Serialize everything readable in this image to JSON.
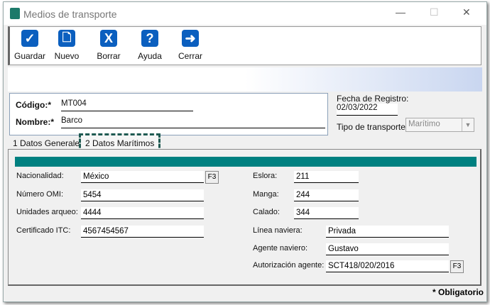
{
  "window": {
    "title": "Medios de transporte",
    "minimize": "—",
    "maximize": "☐",
    "close": "✕"
  },
  "toolbar": [
    {
      "label": "Guardar",
      "icon": "check-icon",
      "glyph": "✓"
    },
    {
      "label": "Nuevo",
      "icon": "document-icon",
      "glyph": "🗋"
    },
    {
      "label": "Borrar",
      "icon": "delete-x-icon",
      "glyph": "X"
    },
    {
      "label": "Ayuda",
      "icon": "help-icon",
      "glyph": "?"
    },
    {
      "label": "Cerrar",
      "icon": "exit-door-icon",
      "glyph": "➜"
    }
  ],
  "header": {
    "codigo_label": "Código:*",
    "codigo": "MT004",
    "nombre_label": "Nombre:*",
    "nombre": "Barco",
    "fecha_label": "Fecha de Registro:",
    "fecha": "02/03/2022",
    "tipo_label": "Tipo de transporte:*",
    "tipo": "Marítimo"
  },
  "tabs": [
    {
      "label": "1 Datos Generales"
    },
    {
      "label": "2 Datos Marítimos",
      "active": true
    }
  ],
  "left_fields": [
    {
      "label": "Nacionalidad:",
      "value": "México",
      "f3": "F3"
    },
    {
      "label": "Número OMI:",
      "value": "5454"
    },
    {
      "label": "Unidades arqueo:",
      "value": "4444"
    },
    {
      "label": "Certificado ITC:",
      "value": "4567454567"
    }
  ],
  "right_fields": [
    {
      "label": "Eslora:",
      "value": "211"
    },
    {
      "label": "Manga:",
      "value": "244"
    },
    {
      "label": "Calado:",
      "value": "344"
    },
    {
      "label": "Línea naviera:",
      "value": "Privada"
    },
    {
      "label": "Agente naviero:",
      "value": "Gustavo"
    },
    {
      "label": "Autorización agente:",
      "value": "SCT418/020/2016",
      "f3": "F3"
    }
  ],
  "footer": {
    "required_note": "* Obligatorio"
  },
  "colors": {
    "accent": "#008080",
    "icon_blue": "#0b5fbf"
  }
}
